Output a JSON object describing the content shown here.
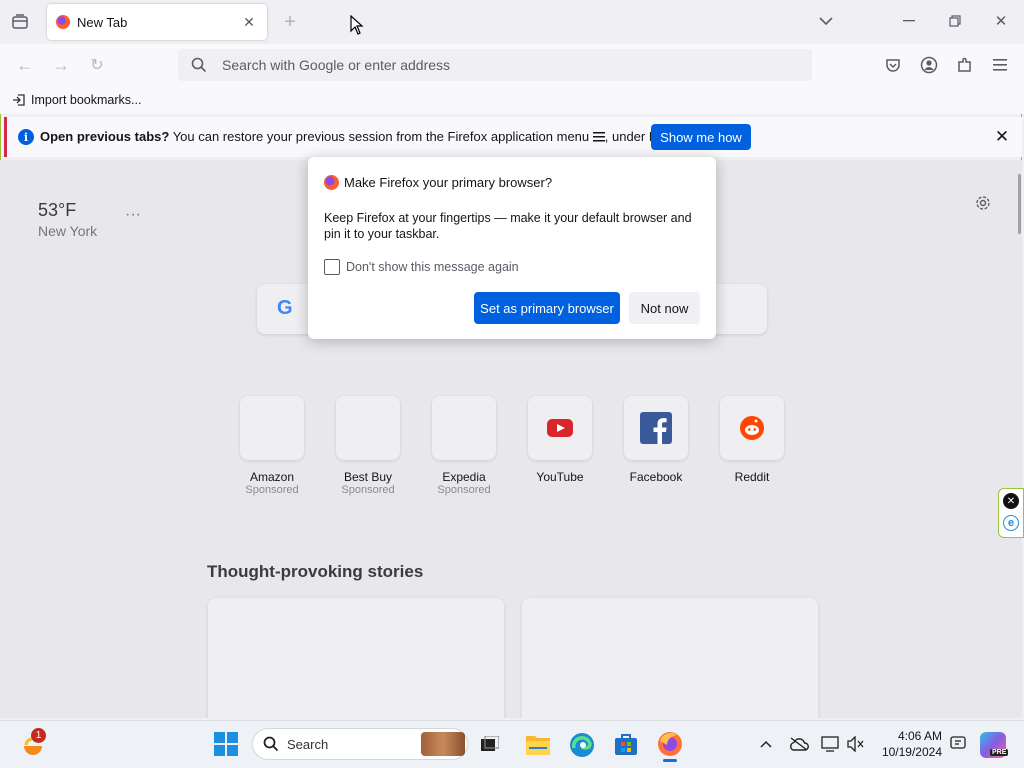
{
  "browser": {
    "tab": {
      "title": "New Tab"
    },
    "urlbar": {
      "placeholder": "Search with Google or enter address"
    },
    "bookmarks": {
      "import_label": "Import bookmarks..."
    },
    "infobar": {
      "bold_text": "Open previous tabs?",
      "text": " You can restore your previous session from the Firefox application menu ",
      "text_tail": ", under History.",
      "button_label": "Show me how"
    }
  },
  "newtab": {
    "weather": {
      "temp": "53°F",
      "city": "New York",
      "more": "···"
    },
    "shortcuts": [
      {
        "label": "Amazon",
        "sub": "Sponsored"
      },
      {
        "label": "Best Buy",
        "sub": "Sponsored"
      },
      {
        "label": "Expedia",
        "sub": "Sponsored"
      },
      {
        "label": "YouTube",
        "sub": ""
      },
      {
        "label": "Facebook",
        "sub": ""
      },
      {
        "label": "Reddit",
        "sub": ""
      }
    ],
    "stories_heading": "Thought-provoking stories"
  },
  "dialog": {
    "title": "Make Firefox your primary browser?",
    "body": "Keep Firefox at your fingertips — make it your default browser and pin it to your taskbar.",
    "checkbox_label": "Don't show this message again",
    "primary_button": "Set as primary browser",
    "secondary_button": "Not now"
  },
  "taskbar": {
    "search_label": "Search",
    "time": "4:06 AM",
    "date": "10/19/2024",
    "widget_badge": "1",
    "copilot_badge": "PRE"
  },
  "colors": {
    "accent": "#0061e0",
    "frame": "#9ac33a"
  }
}
